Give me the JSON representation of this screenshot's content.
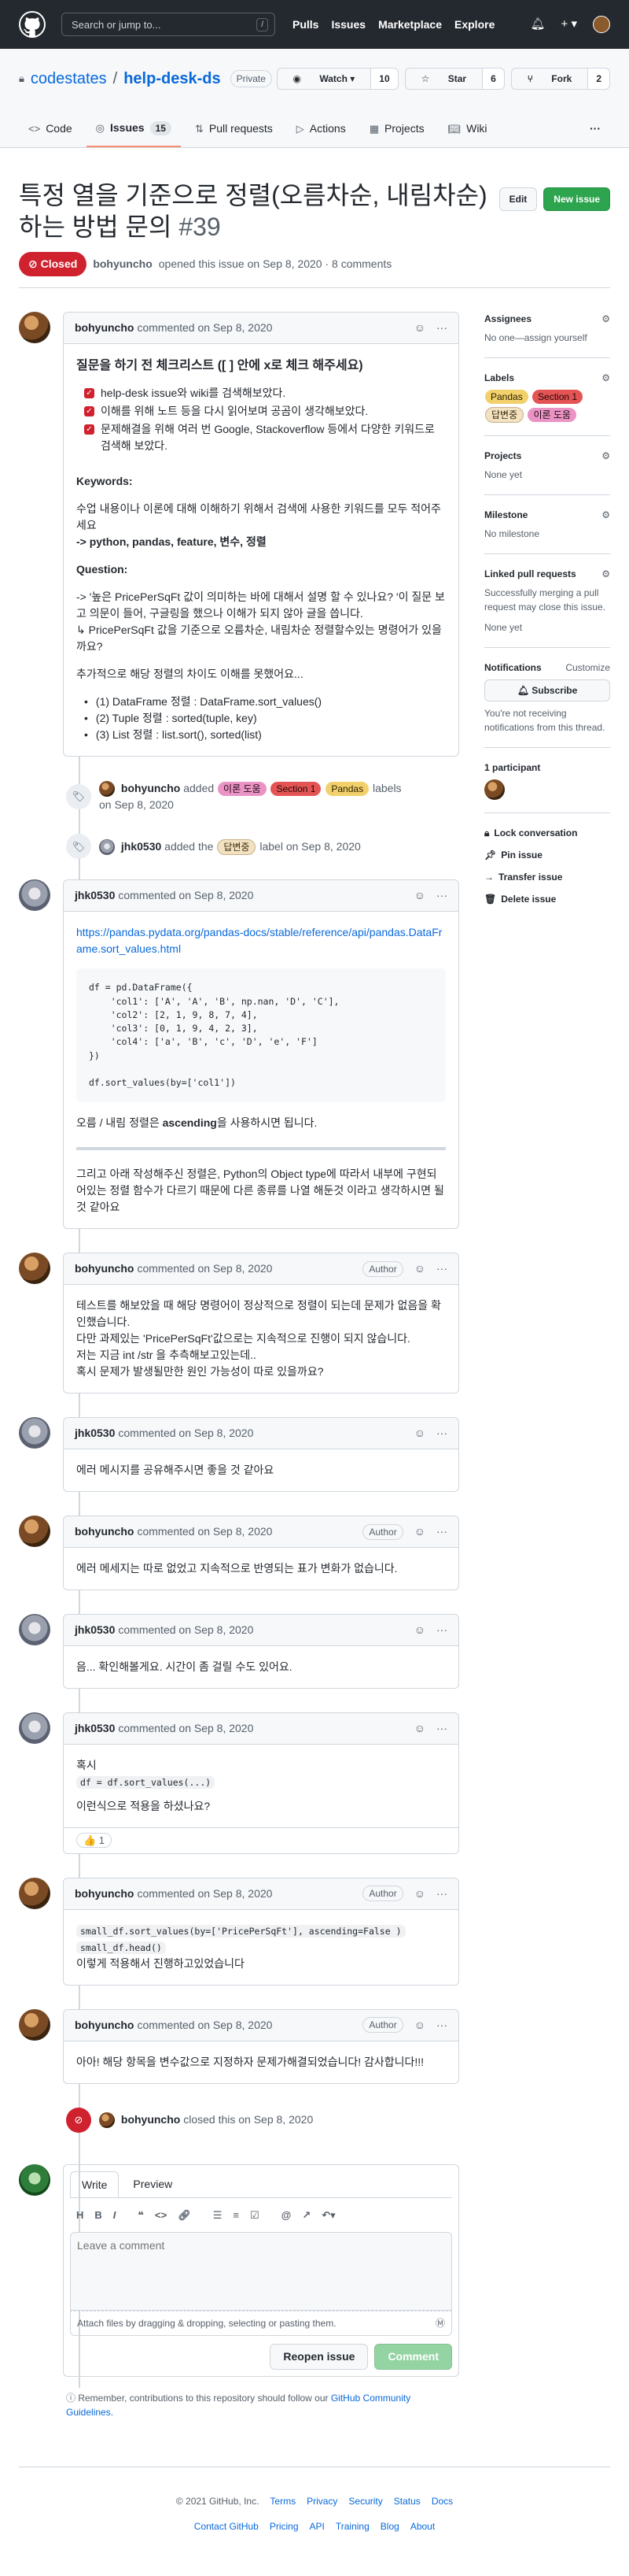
{
  "topbar": {
    "search_placeholder": "Search or jump to...",
    "slash": "/",
    "nav": [
      "Pulls",
      "Issues",
      "Marketplace",
      "Explore"
    ],
    "plus": "+ ▾"
  },
  "repo": {
    "owner": "codestates",
    "name": "help-desk-ds",
    "visibility": "Private",
    "watch_label": "Watch ▾",
    "watch_count": "10",
    "star_label": "Star",
    "star_count": "6",
    "fork_label": "Fork",
    "fork_count": "2",
    "nav": {
      "code": "Code",
      "issues": "Issues",
      "issues_count": "15",
      "pulls": "Pull requests",
      "actions": "Actions",
      "projects": "Projects",
      "wiki": "Wiki",
      "more": "···"
    }
  },
  "issue": {
    "title": "특정 열을 기준으로 정렬(오름차순, 내림차순)하는 방법 문의",
    "number": "#39",
    "edit_label": "Edit",
    "new_issue_label": "New issue",
    "state": "Closed",
    "author": "bohyuncho",
    "opened_text": "opened this issue on Sep 8, 2020 · 8 comments"
  },
  "first_comment": {
    "author": "bohyuncho",
    "meta": "commented on Sep 8, 2020",
    "heading": "질문을 하기 전 체크리스트 ([ ] 안에 x로 체크 해주세요)",
    "checklist": [
      "help-desk issue와 wiki를 검색해보았다.",
      "이해를 위해 노트 등을 다시 읽어보며 공곰이 생각해보았다.",
      "문제해결을 위해 여러 번 Google, Stackoverflow 등에서 다양한 키워드로 검색해 보았다."
    ],
    "keywords_title": "Keywords:",
    "keywords_desc": "수업 내용이나 이론에 대해 이해하기 위해서 검색에 사용한 키워드를 모두 적어주세요",
    "keywords_value": "-> python, pandas, feature, 변수, 정렬",
    "question_title": "Question:",
    "question_line1": "-> '높은 PricePerSqFt 값이 의미하는 바에 대해서 설명 할 수 있나요? '이 질문 보고 의문이 들어, 구글링을 했으나 이해가 되지 않아 글을 씁니다.",
    "question_line2": "↳ PricePerSqFt 값을 기준으로 오름차순, 내림차순 정렬할수있는 명령어가 있을까요?",
    "extra": "추가적으로 해당 정렬의 차이도 이해를 못했어요...",
    "list": [
      "(1) DataFrame 정렬 : DataFrame.sort_values()",
      "(2) Tuple 정렬 : sorted(tuple, key)",
      "(3) List 정렬 : list.sort(), sorted(list)"
    ]
  },
  "label_event": {
    "author": "bohyuncho",
    "added": "added",
    "labels": [
      "이론 도움",
      "Section 1",
      "Pandas"
    ],
    "suffix": "labels",
    "date": "on Sep 8, 2020"
  },
  "label_event2": {
    "author": "jhk0530",
    "text": "added the",
    "label": "답변중",
    "suffix": "label on Sep 8, 2020"
  },
  "comments": [
    {
      "author": "jhk0530",
      "meta": "commented on Sep 8, 2020",
      "link": "https://pandas.pydata.org/pandas-docs/stable/reference/api/pandas.DataFrame.sort_values.html",
      "code_lines": [
        "df = pd.DataFrame({",
        "    'col1': ['A', 'A', 'B', np.nan, 'D', 'C'],",
        "    'col2': [2, 1, 9, 8, 7, 4],",
        "    'col3': [0, 1, 9, 4, 2, 3],",
        "    'col4': ['a', 'B', 'c', 'D', 'e', 'F']",
        "})",
        "",
        "df.sort_values(by=['col1'])"
      ],
      "text1_pre": "오름 / 내림 정렬은",
      "text1_bold": "ascending",
      "text1_post": "을 사용하시면 됩니다.",
      "text2": "그리고 아래 작성해주신 정렬은, Python의 Object type에 따라서 내부에 구현되어있는 정렬 함수가 다르기 때문에 다른 종류를 나열 해둔것 이라고 생각하시면 될 것 같아요"
    },
    {
      "author": "bohyuncho",
      "meta": "commented on Sep 8, 2020",
      "badge": "Author",
      "lines": [
        "테스트를 해보았을 때 해당 명령어이 정상적으로 정렬이 되는데 문제가 없음을 확인했습니다.",
        "다만 과제있는 'PricePerSqFt'값으로는 지속적으로 진행이 되지 않습니다.",
        "저는 지금 int /str 을 추측해보고있는데..",
        "혹시 문제가 발생될만한 원인 가능성이 따로 있을까요?"
      ]
    },
    {
      "author": "jhk0530",
      "meta": "commented on Sep 8, 2020",
      "text": "에러 메시지를 공유해주시면 좋을 것 같아요"
    },
    {
      "author": "bohyuncho",
      "meta": "commented on Sep 8, 2020",
      "badge": "Author",
      "text": "에러 메세지는 따로 없었고 지속적으로 반영되는 표가 변화가 없습니다."
    },
    {
      "author": "jhk0530",
      "meta": "commented on Sep 8, 2020",
      "text": "음... 확인해볼게요. 시간이 좀 걸릴 수도 있어요."
    },
    {
      "author": "jhk0530",
      "meta": "commented on Sep 8, 2020",
      "line1": "혹시",
      "code": "df = df.sort_values(...)",
      "line2": "이런식으로 적용을 하셨나요?",
      "reaction": "👍 1"
    },
    {
      "author": "bohyuncho",
      "meta": "commented on Sep 8, 2020",
      "badge": "Author",
      "code1": "small_df.sort_values(by=['PricePerSqFt'], ascending=False )",
      "code2": "small_df.head()",
      "text": "이렇게 적용해서 진행하고있었습니다"
    },
    {
      "author": "bohyuncho",
      "meta": "commented on Sep 8, 2020",
      "badge": "Author",
      "text": "아아! 해당 항목을 변수값으로 지정하자 문제가해결되었습니다! 감사합니다!!!"
    }
  ],
  "close_event": {
    "author": "bohyuncho",
    "text": "closed this on Sep 8, 2020"
  },
  "editor": {
    "tab_write": "Write",
    "tab_preview": "Preview",
    "placeholder": "Leave a comment",
    "attach": "Attach files by dragging & dropping, selecting or pasting them.",
    "reopen": "Reopen issue",
    "comment": "Comment"
  },
  "tip": {
    "text": "Remember, contributions to this repository should follow our",
    "link": "GitHub Community Guidelines."
  },
  "sidebar": {
    "assignees_title": "Assignees",
    "assignees_value": "No one—assign yourself",
    "labels_title": "Labels",
    "labels": [
      "Pandas",
      "Section 1",
      "답변중",
      "이론 도움"
    ],
    "projects_title": "Projects",
    "projects_value": "None yet",
    "milestone_title": "Milestone",
    "milestone_value": "No milestone",
    "linked_title": "Linked pull requests",
    "linked_value": "Successfully merging a pull request may close this issue.",
    "linked_value2": "None yet",
    "notif_title": "Notifications",
    "notif_customize": "Customize",
    "subscribe": "Subscribe",
    "notif_desc": "You're not receiving notifications from this thread.",
    "participants": "1 participant",
    "lock": "Lock conversation",
    "pin": "Pin issue",
    "transfer": "Transfer issue",
    "delete": "Delete issue"
  },
  "footer": {
    "copyright": "© 2021 GitHub, Inc.",
    "row1": [
      "Terms",
      "Privacy",
      "Security",
      "Status",
      "Docs"
    ],
    "row2": [
      "Contact GitHub",
      "Pricing",
      "API",
      "Training",
      "Blog",
      "About"
    ]
  }
}
